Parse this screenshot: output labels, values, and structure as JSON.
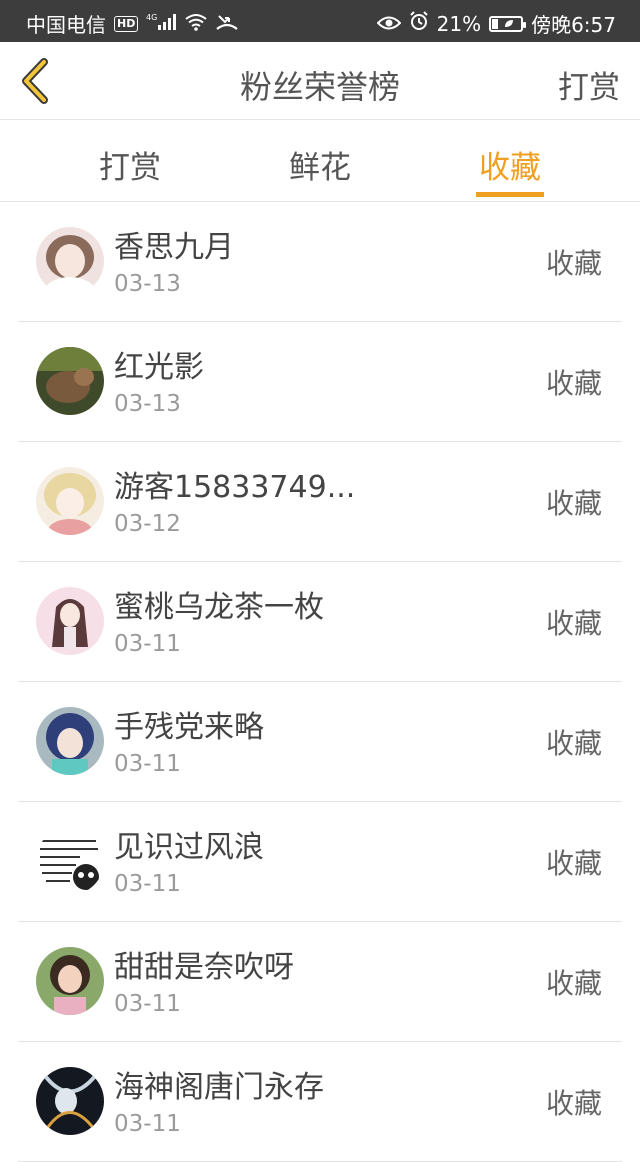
{
  "status": {
    "carrier": "中国电信",
    "hd": "HD",
    "network": "4G",
    "battery": "21%",
    "time": "傍晚6:57"
  },
  "header": {
    "title": "粉丝荣誉榜",
    "action": "打赏"
  },
  "tabs": [
    {
      "label": "打赏",
      "active": false
    },
    {
      "label": "鲜花",
      "active": false
    },
    {
      "label": "收藏",
      "active": true
    }
  ],
  "list": [
    {
      "name": "香思九月",
      "date": "03-13",
      "action": "收藏"
    },
    {
      "name": "红光影",
      "date": "03-13",
      "action": "收藏"
    },
    {
      "name": "游客15833749...",
      "date": "03-12",
      "action": "收藏"
    },
    {
      "name": "蜜桃乌龙茶一枚",
      "date": "03-11",
      "action": "收藏"
    },
    {
      "name": "手残党来略",
      "date": "03-11",
      "action": "收藏"
    },
    {
      "name": "见识过风浪",
      "date": "03-11",
      "action": "收藏"
    },
    {
      "name": "甜甜是奈吹呀",
      "date": "03-11",
      "action": "收藏"
    },
    {
      "name": "海神阁唐门永存",
      "date": "03-11",
      "action": "收藏"
    }
  ],
  "colors": {
    "accent": "#f0a020",
    "status_bar": "#3d3d3d",
    "divider": "#e3e3e3"
  }
}
